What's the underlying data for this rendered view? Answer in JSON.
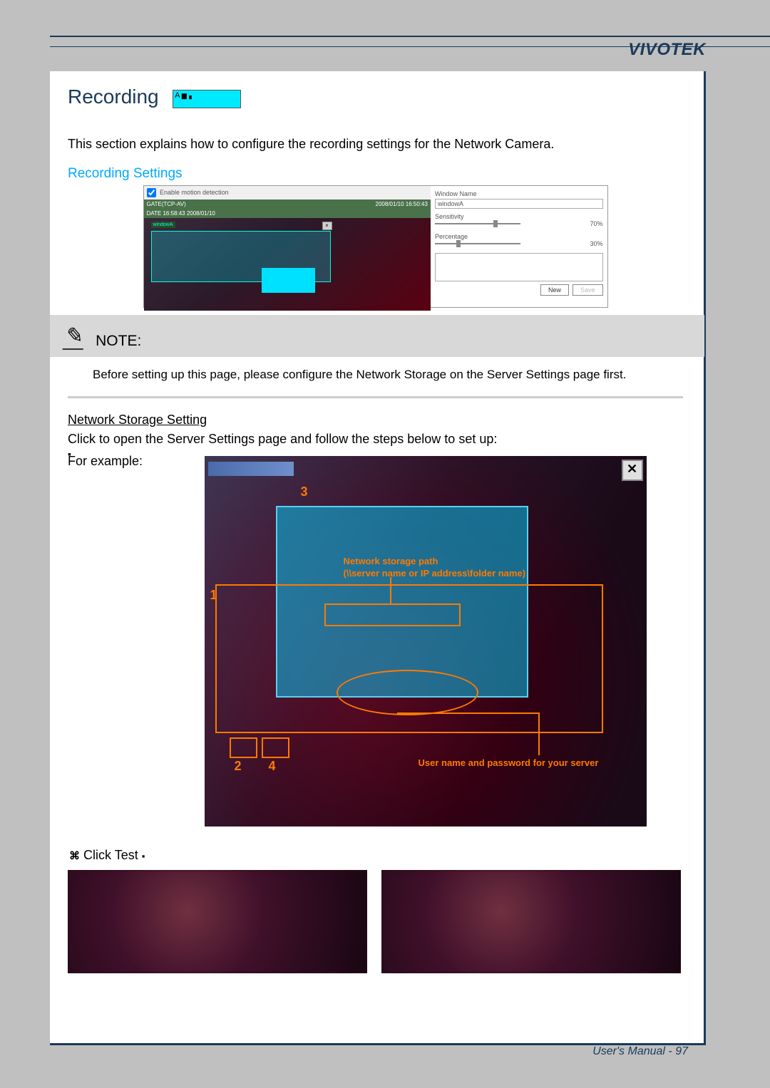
{
  "brand": "VIVOTEK",
  "heading_title": "Recording",
  "heading_badge_label": "A",
  "intro_text": "This section explains how to configure the recording settings for the Network Camera.",
  "subheading": "Recording Settings",
  "motion_panel": {
    "checkbox_label": "Enable motion detection",
    "top_left": "GATE(TCP-AV)",
    "top_right": "2008/01/10 16:50:43",
    "status": "DATE 16:58:43  2008/01/10",
    "win_label": "windowA",
    "window_name_label": "Window Name",
    "window_name_value": "windowA",
    "sensitivity_label": "Sensitivity",
    "sensitivity_value": "70%",
    "percentage_label": "Percentage",
    "percentage_value": "30%",
    "new_btn": "New",
    "save_btn": "Save"
  },
  "note_label": "NOTE:",
  "note_text": "Before setting up this page, please configure the Network Storage on the Server Settings page first.",
  "section2_title": "Network Storage Setting",
  "section2_text": "Click to open the Server Settings page and follow the steps below to set up:",
  "example_label": "For example:",
  "diagram_labels": {
    "n1": "1",
    "n2": "2",
    "n3": "3",
    "n4": "4",
    "path_label1": "Network storage path",
    "path_label2": "(\\\\server name or IP address\\folder name)",
    "user_label": "User name and password for your server",
    "close_x": "✕"
  },
  "test_text": "Click Test",
  "footer": "User's Manual - 97"
}
